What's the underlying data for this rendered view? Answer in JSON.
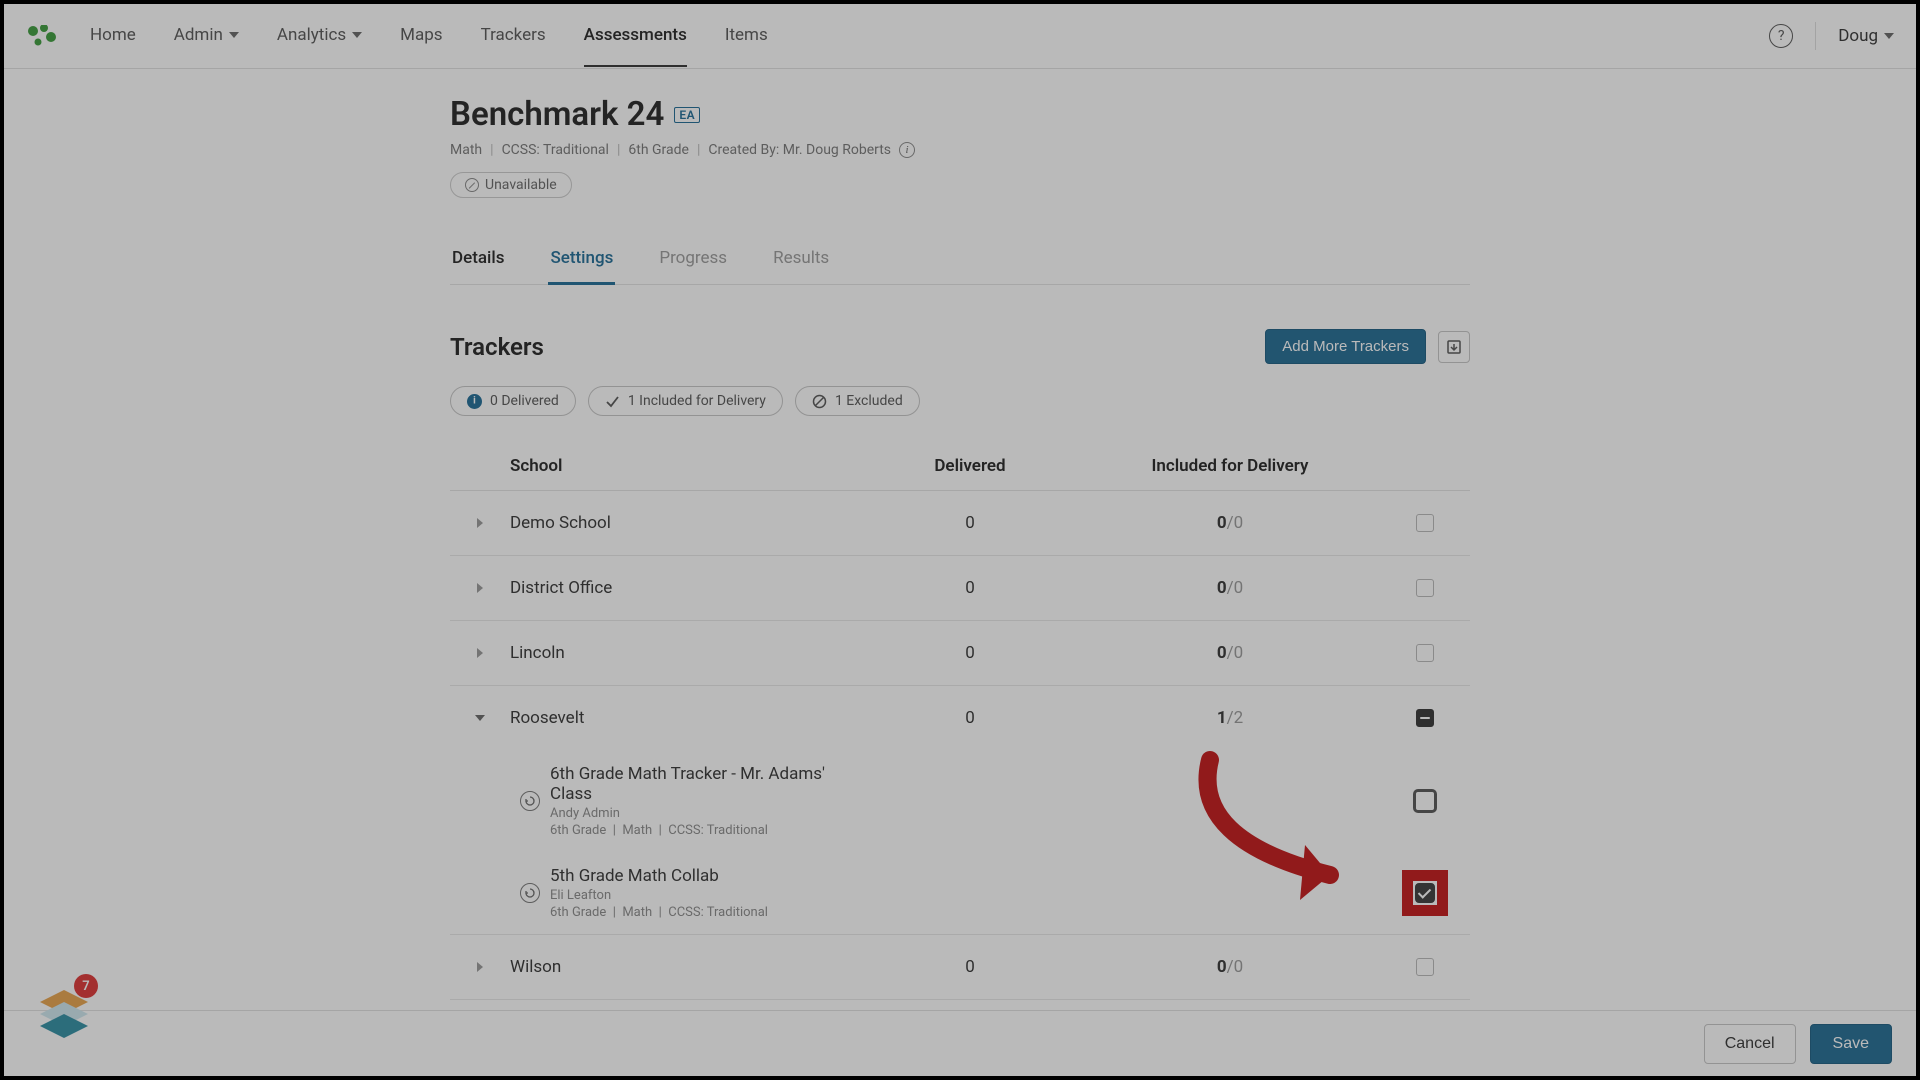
{
  "nav": {
    "items": [
      "Home",
      "Admin",
      "Analytics",
      "Maps",
      "Trackers",
      "Assessments",
      "Items"
    ],
    "active": "Assessments",
    "dropdowns": [
      "Admin",
      "Analytics"
    ],
    "user": "Doug"
  },
  "page": {
    "title": "Benchmark 24",
    "badge": "EA",
    "meta": {
      "subject": "Math",
      "standard": "CCSS: Traditional",
      "grade": "6th Grade",
      "created_by_label": "Created By:",
      "created_by": "Mr. Doug Roberts"
    },
    "status": "Unavailable"
  },
  "tabs": [
    "Details",
    "Settings",
    "Progress",
    "Results"
  ],
  "tabs_active": "Settings",
  "section": {
    "title": "Trackers",
    "add_button": "Add More Trackers"
  },
  "filters": {
    "delivered": "0 Delivered",
    "included": "1 Included for Delivery",
    "excluded": "1 Excluded"
  },
  "columns": {
    "school": "School",
    "delivered": "Delivered",
    "included": "Included for Delivery"
  },
  "rows": [
    {
      "name": "Demo School",
      "delivered": "0",
      "inc_a": "0",
      "inc_b": "/0",
      "expanded": false,
      "check": "empty"
    },
    {
      "name": "District Office",
      "delivered": "0",
      "inc_a": "0",
      "inc_b": "/0",
      "expanded": false,
      "check": "empty"
    },
    {
      "name": "Lincoln",
      "delivered": "0",
      "inc_a": "0",
      "inc_b": "/0",
      "expanded": false,
      "check": "empty"
    },
    {
      "name": "Roosevelt",
      "delivered": "0",
      "inc_a": "1",
      "inc_b": "/2",
      "expanded": true,
      "check": "indeterminate"
    },
    {
      "name": "Wilson",
      "delivered": "0",
      "inc_a": "0",
      "inc_b": "/0",
      "expanded": false,
      "check": "empty"
    }
  ],
  "roosevelt_children": [
    {
      "title": "6th Grade Math Tracker - Mr. Adams' Class",
      "owner": "Andy Admin",
      "grade": "6th Grade",
      "subject": "Math",
      "standard": "CCSS: Traditional",
      "check": "outlined"
    },
    {
      "title": "5th Grade Math Collab",
      "owner": "Eli Leafton",
      "grade": "6th Grade",
      "subject": "Math",
      "standard": "CCSS: Traditional",
      "check": "checked-highlight"
    }
  ],
  "footer": {
    "cancel": "Cancel",
    "save": "Save"
  },
  "dock": {
    "badge": "7"
  }
}
